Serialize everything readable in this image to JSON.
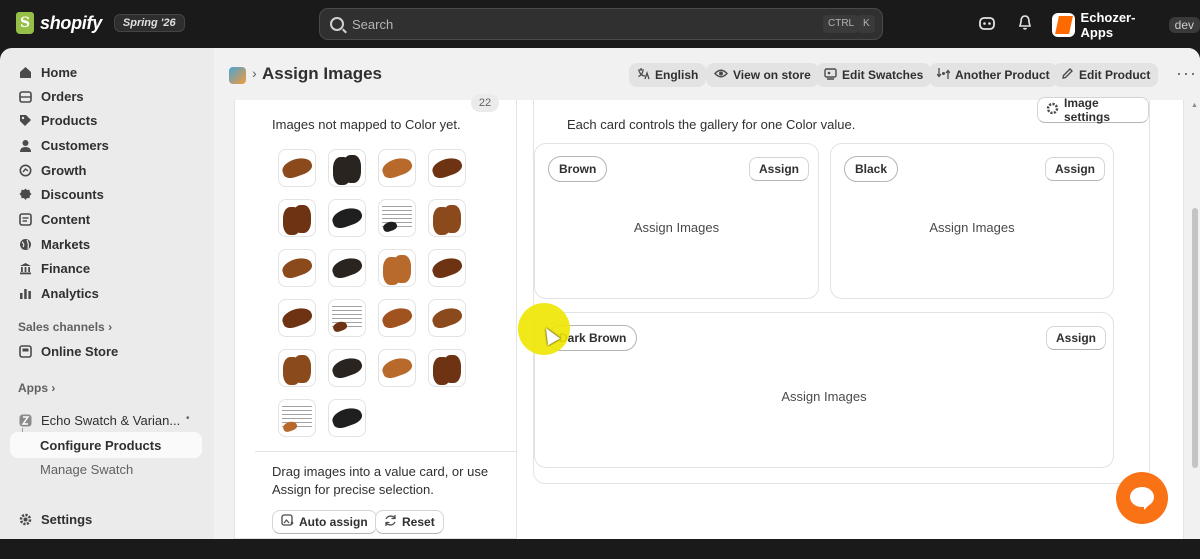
{
  "topbar": {
    "brand": "shopify",
    "badge": "Spring '26",
    "search_placeholder": "Search",
    "shortcut_ctrl": "CTRL",
    "shortcut_key": "K",
    "store_name": "Echozer-Apps",
    "store_env": "dev"
  },
  "sidebar": {
    "items": [
      {
        "label": "Home",
        "icon": "home-icon"
      },
      {
        "label": "Orders",
        "icon": "orders-icon"
      },
      {
        "label": "Products",
        "icon": "tag-icon"
      },
      {
        "label": "Customers",
        "icon": "person-icon"
      },
      {
        "label": "Growth",
        "icon": "growth-icon"
      },
      {
        "label": "Discounts",
        "icon": "discount-icon"
      },
      {
        "label": "Content",
        "icon": "content-icon"
      },
      {
        "label": "Markets",
        "icon": "globe-icon"
      },
      {
        "label": "Finance",
        "icon": "bank-icon"
      },
      {
        "label": "Analytics",
        "icon": "chart-icon"
      }
    ],
    "sales_channels_label": "Sales channels",
    "online_store": "Online Store",
    "apps_label": "Apps",
    "app_name": "Echo Swatch & Varian...",
    "app_subitems": [
      "Configure Products",
      "Manage Swatch"
    ],
    "settings": "Settings"
  },
  "header": {
    "title": "Assign Images",
    "buttons": [
      "English",
      "View on store",
      "Edit Swatches",
      "Another Product",
      "Edit Product"
    ]
  },
  "left_panel": {
    "count": "22",
    "description": "Images not mapped to Color yet.",
    "hint": "Drag images into a value card, or use Assign for precise selection.",
    "auto_assign": "Auto assign",
    "reset": "Reset"
  },
  "right_panel": {
    "description": "Each card controls the gallery for one Color value.",
    "settings_button": "Image settings",
    "cards": [
      {
        "value": "Brown",
        "assign": "Assign",
        "placeholder": "Assign Images"
      },
      {
        "value": "Black",
        "assign": "Assign",
        "placeholder": "Assign Images"
      },
      {
        "value": "Dark Brown",
        "assign": "Assign",
        "placeholder": "Assign Images"
      }
    ]
  },
  "colors": {
    "topbar": "#1a1a1a",
    "sidebar": "#ebebeb",
    "accent_orange": "#f97316",
    "cursor_highlight": "#f0e600"
  }
}
